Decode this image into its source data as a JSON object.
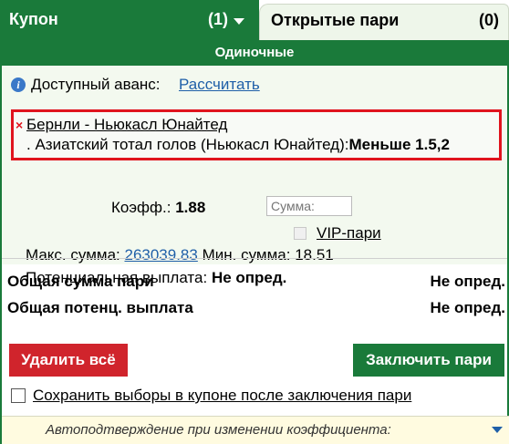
{
  "tabs": {
    "coupon": {
      "label": "Купон",
      "count": "(1)"
    },
    "open_bets": {
      "label": "Открытые пари",
      "count": "(0)"
    }
  },
  "section": {
    "title": "Одиночные"
  },
  "advance": {
    "label": "Доступный аванс:",
    "link": "Рассчитать"
  },
  "bet": {
    "remove": "×",
    "match": "Бернли - Ньюкасл Юнайтед",
    "market": ". Азиатский тотал голов (Ньюкасл Юнайтед):",
    "selection": "Меньше 1.5,2",
    "odds_label": "Коэфф.:",
    "odds_value": "1.88",
    "stake_placeholder": "Сумма:",
    "vip_label": "VIP-пари",
    "max_label": "Макс. сумма:",
    "max_value": "263039.83",
    "min_label": "Мин. сумма:",
    "min_value": "18.51",
    "payout_label": "Потенциальная выплата:",
    "payout_value": "Не опред."
  },
  "totals": {
    "total_stake_label": "Общая сумма пари",
    "total_stake_value": "Не опред.",
    "total_payout_label": "Общая потенц. выплата",
    "total_payout_value": "Не опред."
  },
  "actions": {
    "delete_all": "Удалить всё",
    "place_bet": "Заключить пари",
    "save_selections": "Сохранить выборы в купоне после заключения пари"
  },
  "autoconfirm": {
    "label": "Автоподтверждение при изменении коэффициента:"
  },
  "colors": {
    "brand_green": "#1a7a3a",
    "delete_red": "#d0242c",
    "highlight_red": "#e0141e",
    "link_blue": "#1f5fa8"
  },
  "icons": [
    "info-icon",
    "chevron-down-icon",
    "close-icon"
  ]
}
